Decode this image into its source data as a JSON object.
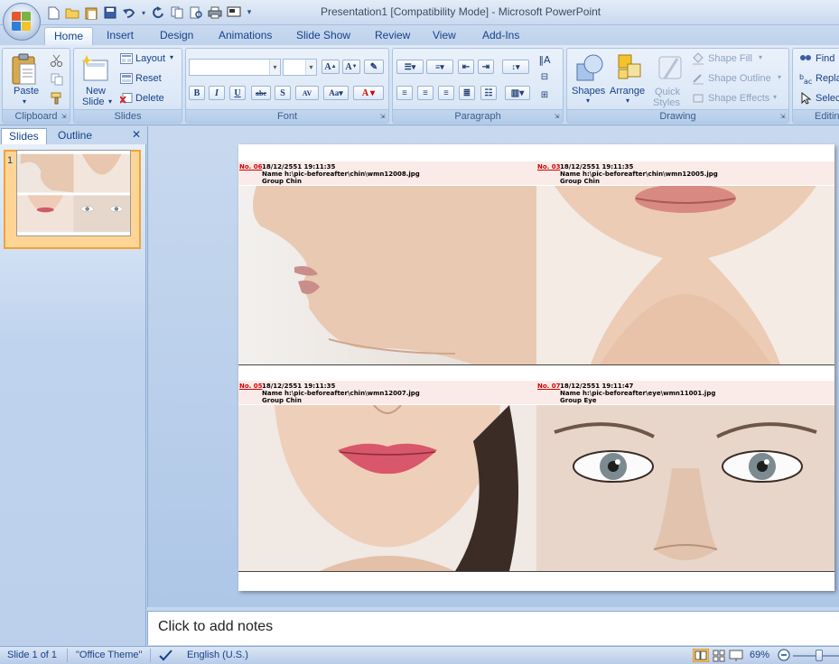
{
  "window": {
    "title": "Presentation1 [Compatibility Mode] - Microsoft PowerPoint"
  },
  "qat": {
    "icons": [
      "new-icon",
      "open-icon",
      "save-icon",
      "undo-icon",
      "redo-icon",
      "print-icon",
      "print-preview-icon",
      "spelling-icon"
    ]
  },
  "tabs": [
    "Home",
    "Insert",
    "Design",
    "Animations",
    "Slide Show",
    "Review",
    "View",
    "Add-Ins"
  ],
  "ribbon": {
    "clipboard": {
      "label": "Clipboard",
      "paste": "Paste"
    },
    "slides": {
      "label": "Slides",
      "new_slide_1": "New",
      "new_slide_2": "Slide",
      "layout": "Layout",
      "reset": "Reset",
      "delete": "Delete"
    },
    "font": {
      "label": "Font",
      "font_name": "",
      "font_size": ""
    },
    "paragraph": {
      "label": "Paragraph"
    },
    "drawing": {
      "label": "Drawing",
      "shapes": "Shapes",
      "arrange": "Arrange",
      "quick_1": "Quick",
      "quick_2": "Styles",
      "shape_fill": "Shape Fill",
      "shape_outline": "Shape Outline",
      "shape_effects": "Shape Effects"
    },
    "editing": {
      "label": "Editin",
      "find": "Find",
      "replace": "Repla",
      "select": "Selec"
    }
  },
  "panel": {
    "tab_slides": "Slides",
    "tab_outline": "Outline",
    "slide_number": "1"
  },
  "slide": {
    "cells": [
      {
        "no": "No. 06",
        "date": "18/12/2551 19:11:35",
        "name": "Name h:\\pic-beforeafter\\chin\\wmn12008.jpg",
        "group": "Group Chin"
      },
      {
        "no": "No. 03",
        "date": "18/12/2551 19:11:35",
        "name": "Name h:\\pic-beforeafter\\chin\\wmn12005.jpg",
        "group": "Group Chin"
      },
      {
        "no": "No. 05",
        "date": "18/12/2551 19:11:35",
        "name": "Name h:\\pic-beforeafter\\chin\\wmn12007.jpg",
        "group": "Group Chin"
      },
      {
        "no": "No. 07",
        "date": "18/12/2551 19:11:47",
        "name": "Name h:\\pic-beforeafter\\eye\\wmn11001.jpg",
        "group": "Group Eye"
      }
    ]
  },
  "notes": {
    "placeholder": "Click to add notes"
  },
  "status": {
    "slide": "Slide 1 of 1",
    "theme": "\"Office Theme\"",
    "language": "English (U.S.)",
    "zoom": "69%"
  },
  "colors": {
    "accent": "#15428b",
    "selection": "#f0a33a",
    "header_pink": "#fbebe8",
    "number_red": "#d00000"
  }
}
